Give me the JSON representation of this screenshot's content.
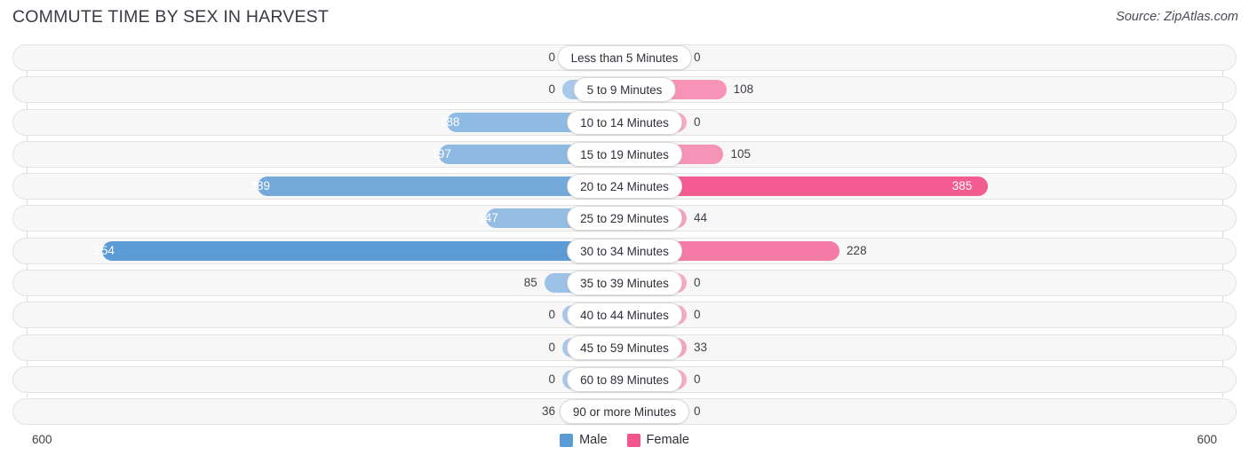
{
  "header": {
    "title": "COMMUTE TIME BY SEX IN HARVEST",
    "source": "Source: ZipAtlas.com"
  },
  "footer": {
    "axis_min_label": "600",
    "axis_max_label": "600",
    "legend": [
      {
        "label": "Male",
        "color": "#5b9bd5",
        "icon": "square-swatch-icon"
      },
      {
        "label": "Female",
        "color": "#f2558c",
        "icon": "square-swatch-icon"
      }
    ]
  },
  "chart_data": {
    "type": "bar",
    "orientation": "horizontal-diverging",
    "title": "COMMUTE TIME BY SEX IN HARVEST",
    "xlabel": "",
    "ylabel": "",
    "axis_max": 600,
    "axis_min_label": "600",
    "axis_max_label": "600",
    "grid": true,
    "legend_position": "bottom-center",
    "categories": [
      "Less than 5 Minutes",
      "5 to 9 Minutes",
      "10 to 14 Minutes",
      "15 to 19 Minutes",
      "20 to 24 Minutes",
      "25 to 29 Minutes",
      "30 to 34 Minutes",
      "35 to 39 Minutes",
      "40 to 44 Minutes",
      "45 to 59 Minutes",
      "60 to 89 Minutes",
      "90 or more Minutes"
    ],
    "series": [
      {
        "name": "Male",
        "color": "#5b9bd5",
        "direction": "left",
        "values": [
          0,
          0,
          188,
          197,
          389,
          147,
          554,
          85,
          0,
          0,
          0,
          36
        ],
        "labels": [
          "0",
          "0",
          "188",
          "197",
          "389",
          "147",
          "554",
          "85",
          "0",
          "0",
          "0",
          "36"
        ]
      },
      {
        "name": "Female",
        "color": "#f2558c",
        "direction": "right",
        "values": [
          0,
          108,
          0,
          105,
          385,
          44,
          228,
          0,
          0,
          33,
          0,
          0
        ],
        "labels": [
          "0",
          "108",
          "0",
          "105",
          "385",
          "44",
          "228",
          "0",
          "0",
          "33",
          "0",
          "0"
        ]
      }
    ]
  }
}
